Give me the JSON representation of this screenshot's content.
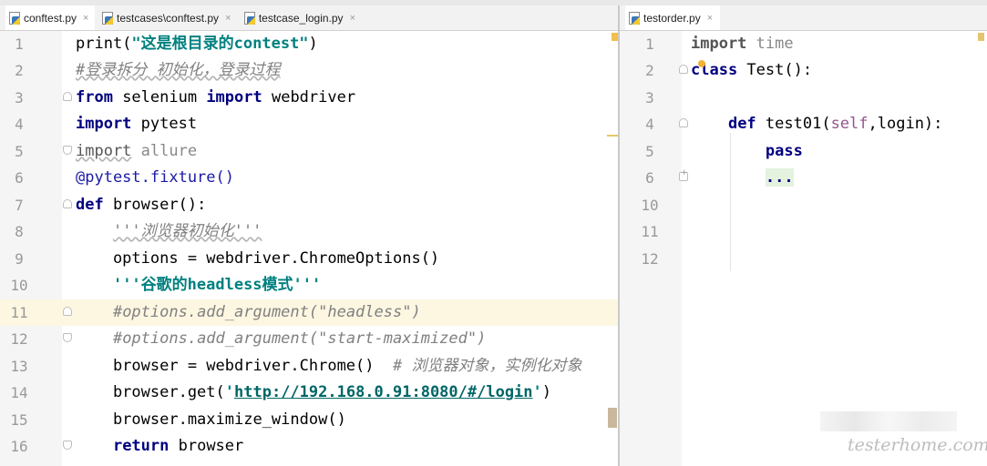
{
  "left_tabs": [
    {
      "label": "conftest.py",
      "close": "×",
      "active": true
    },
    {
      "label": "testcases\\conftest.py",
      "close": "×",
      "active": false
    },
    {
      "label": "testcase_login.py",
      "close": "×",
      "active": false
    }
  ],
  "right_tabs": [
    {
      "label": "testorder.py",
      "close": "×",
      "active": true
    }
  ],
  "left_editor": {
    "line_numbers": [
      "1",
      "2",
      "3",
      "4",
      "5",
      "6",
      "7",
      "8",
      "9",
      "10",
      "11",
      "12",
      "13",
      "14",
      "15",
      "16"
    ],
    "current_line": "11",
    "lines": {
      "l1": {
        "a": "print(",
        "b": "\"这是根目录的contest\"",
        "c": ")"
      },
      "l2": {
        "a": "#登录拆分 初始化，登录过程"
      },
      "l3": {
        "a": "from",
        "b": " selenium ",
        "c": "import",
        "d": " webdriver"
      },
      "l4": {
        "a": "import",
        "b": " pytest"
      },
      "l5": {
        "a": "import",
        "b": " allure"
      },
      "l6": {
        "a": "@pytest.fixture()"
      },
      "l7": {
        "a": "def",
        "b": " browser():"
      },
      "l8": {
        "a": "    ",
        "b": "'''浏览器初始化'''"
      },
      "l9": {
        "a": "    options = webdriver.ChromeOptions()"
      },
      "l10": {
        "a": "    ",
        "b": "'''谷歌的headless模式'''"
      },
      "l11": {
        "a": "    ",
        "b": "#options.add_argument(\"headless\")"
      },
      "l12": {
        "a": "    ",
        "b": "#options.add_argument(\"start-maximized\")"
      },
      "l13": {
        "a": "    browser = webdriver.Chrome()  ",
        "b": "# 浏览器对象，实例化对象"
      },
      "l14": {
        "a": "    browser.get(",
        "b": "'",
        "c": "http://192.168.0.91:8080/#/login",
        "d": "'",
        "e": ")"
      },
      "l15": {
        "a": "    browser.maximize_window()"
      },
      "l16": {
        "a": "    ",
        "b": "return",
        "c": " browser"
      }
    }
  },
  "right_editor": {
    "line_numbers": [
      "1",
      "2",
      "3",
      "4",
      "5",
      "6",
      "10",
      "11",
      "12"
    ],
    "lines": {
      "r1": {
        "a": "import",
        "b": " time"
      },
      "r2": {
        "a": "class",
        "b": " Test():"
      },
      "r4": {
        "a": "    ",
        "b": "def",
        "c": " test01(",
        "d": "self",
        "e": ",login):"
      },
      "r5": {
        "a": "        ",
        "b": "pass"
      },
      "r6": {
        "a": "        ",
        "b": "..."
      }
    }
  },
  "watermark": "testerhome.com",
  "colors": {
    "keyword": "#000080",
    "string": "#008080",
    "comment": "#808080",
    "current_line": "#fdf7e2",
    "gutter": "#f5f5f5"
  }
}
